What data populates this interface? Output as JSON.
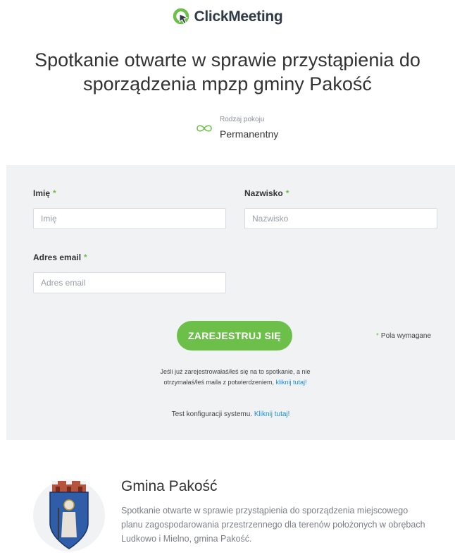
{
  "brand": {
    "name": "ClickMeeting"
  },
  "event": {
    "title": "Spotkanie otwarte w sprawie przystąpienia do sporządzenia mpzp gminy Pakość",
    "room_type_label": "Rodzaj pokoju",
    "room_type_value": "Permanentny"
  },
  "form": {
    "first_name_label": "Imię",
    "first_name_placeholder": "Imię",
    "last_name_label": "Nazwisko",
    "last_name_placeholder": "Nazwisko",
    "email_label": "Adres email",
    "email_placeholder": "Adres email",
    "required_star": "*",
    "submit_label": "ZAREJESTRUJ SIĘ",
    "required_note": "Pola wymagane",
    "resend_text": "Jeśli już zarejestrowałaś/łeś się na to spotkanie, a nie otrzymałaś/łeś maila z potwierdzeniem,",
    "resend_link": "kliknij tutaj!",
    "test_text": "Test konfiguracji systemu.",
    "test_link": "Kliknij tutaj!"
  },
  "organizer": {
    "name": "Gmina Pakość",
    "description": "Spotkanie otwarte w sprawie przystąpienia do sporządzenia miejscowego planu zagospodarowania przestrzennego dla terenów położonych w obrębach Ludkowo i Mielno, gmina Pakość."
  },
  "colors": {
    "accent": "#6cc04a",
    "link": "#1b8fd6",
    "panel": "#f1f2f4"
  }
}
